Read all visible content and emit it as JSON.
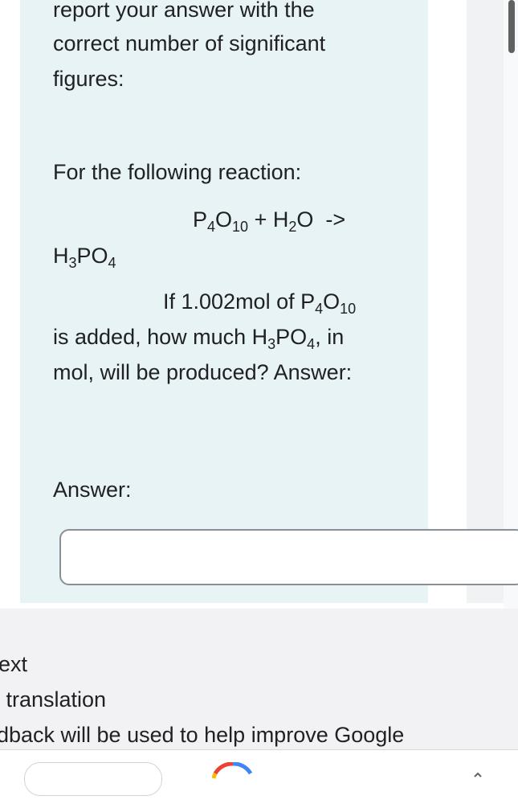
{
  "question": {
    "line1": "report your answer with the",
    "line2": "correct number of significant",
    "line3": "figures:",
    "intro": "For the following reaction:",
    "reaction_lhs": {
      "p": "P",
      "p_sub": "4",
      "o": "O",
      "o_sub": "10",
      "plus": " + H",
      "h_sub": "2",
      "water_o": "O",
      "arrow": "  ->"
    },
    "reaction_rhs": {
      "h": "H",
      "h_sub": "3",
      "po": "PO",
      "po_sub": "4"
    },
    "ask_line1": {
      "text": "If 1.002mol of P",
      "p_sub": "4",
      "o": "O",
      "o_sub": "10"
    },
    "ask_line2": {
      "prefix": "is added, how much H",
      "h_sub": "3",
      "po": "PO",
      "po_sub": "4",
      "suffix": ", in"
    },
    "ask_line3": "mol, will be produced? Answer:",
    "answer_label": "Answer:",
    "answer_value": ""
  },
  "sheet": {
    "line1": "ext",
    "line2": " translation",
    "line3": "dback will be used to help improve Google"
  },
  "colors": {
    "card_bg": "#e7f3f5",
    "sheet_bg": "#f2f2f5",
    "text": "#202124"
  },
  "icons": [
    "google-icon",
    "chevron-up-icon"
  ]
}
